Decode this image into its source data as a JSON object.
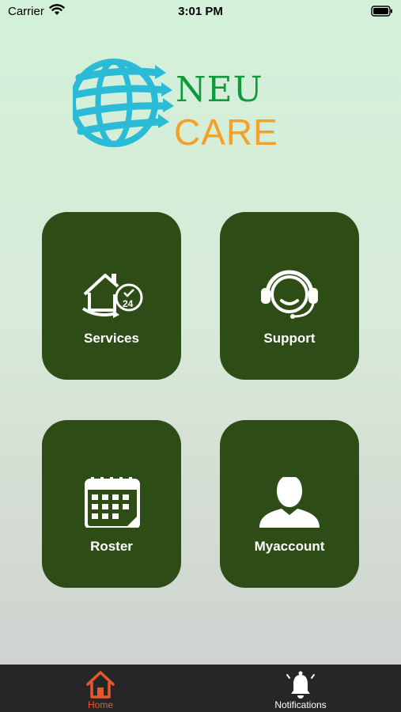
{
  "status_bar": {
    "carrier": "Carrier",
    "time": "3:01 PM"
  },
  "logo": {
    "line1": "NEU",
    "line2": "CARE",
    "colors": {
      "neu": "#0e9a3b",
      "care": "#f5a028",
      "globe": "#2bbbd6"
    }
  },
  "tiles": [
    {
      "label": "Services",
      "icon": "home-service-24-icon"
    },
    {
      "label": "Support",
      "icon": "headset-icon"
    },
    {
      "label": "Roster",
      "icon": "calendar-icon"
    },
    {
      "label": "Myaccount",
      "icon": "user-icon"
    }
  ],
  "tabbar": {
    "items": [
      {
        "label": "Home",
        "icon": "home-icon",
        "active": true
      },
      {
        "label": "Notifications",
        "icon": "bell-icon",
        "active": false
      }
    ],
    "active_color": "#e8582a",
    "tile_color": "#2e4d16"
  }
}
